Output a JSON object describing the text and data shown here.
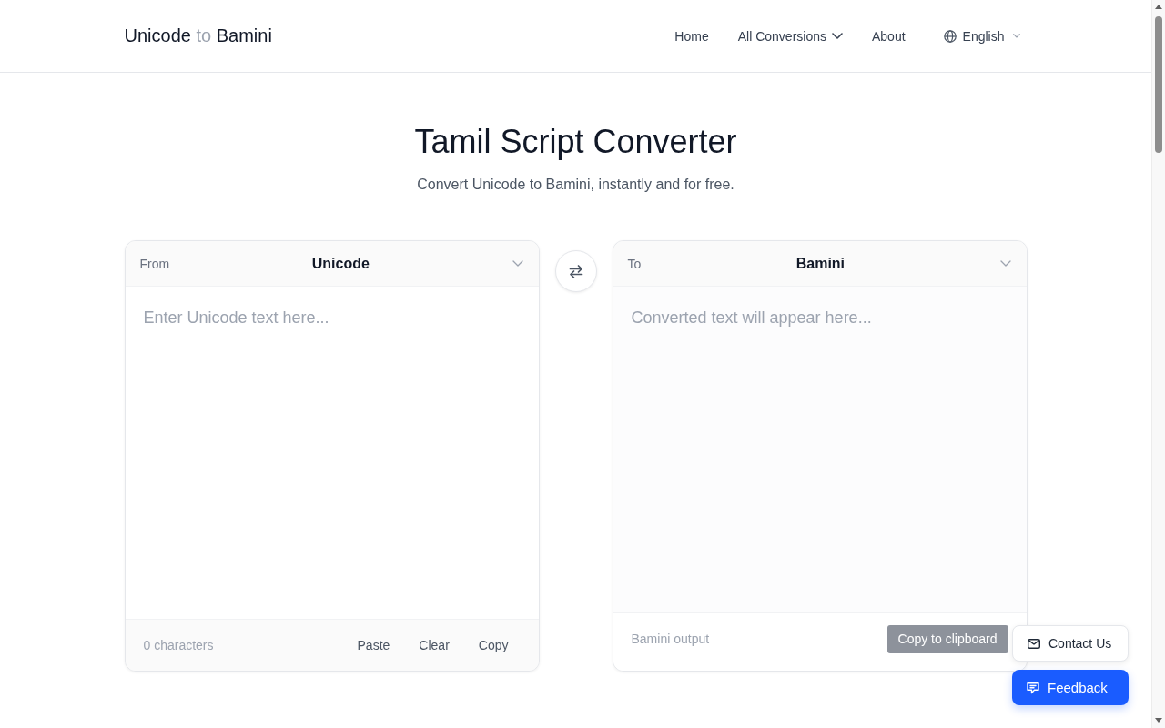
{
  "header": {
    "logo": {
      "name_start": "Unicode",
      "joiner": "to",
      "name_end": "Bamini"
    },
    "nav": [
      {
        "label": "Home",
        "kind": "link"
      },
      {
        "label": "All Conversions",
        "kind": "dropdown"
      },
      {
        "label": "About",
        "kind": "link"
      }
    ],
    "language": {
      "label": "English"
    }
  },
  "hero": {
    "title": "Tamil Script Converter",
    "subtitle": "Convert Unicode to Bamini, instantly and for free."
  },
  "converter": {
    "source": {
      "label": "From",
      "format": "Unicode",
      "placeholder": "Enter Unicode text here...",
      "count": "0 characters",
      "actions": [
        "Paste",
        "Clear",
        "Copy"
      ]
    },
    "target": {
      "label": "To",
      "format": "Bamini",
      "placeholder": "Converted text will appear here...",
      "caption": "Bamini output",
      "copy_button": {
        "label": "Copy to clipboard",
        "disabled": true
      }
    }
  },
  "floating_buttons": [
    {
      "label": "Contact Us",
      "kind": "contact"
    },
    {
      "label": "Feedback",
      "kind": "feedback"
    }
  ]
}
